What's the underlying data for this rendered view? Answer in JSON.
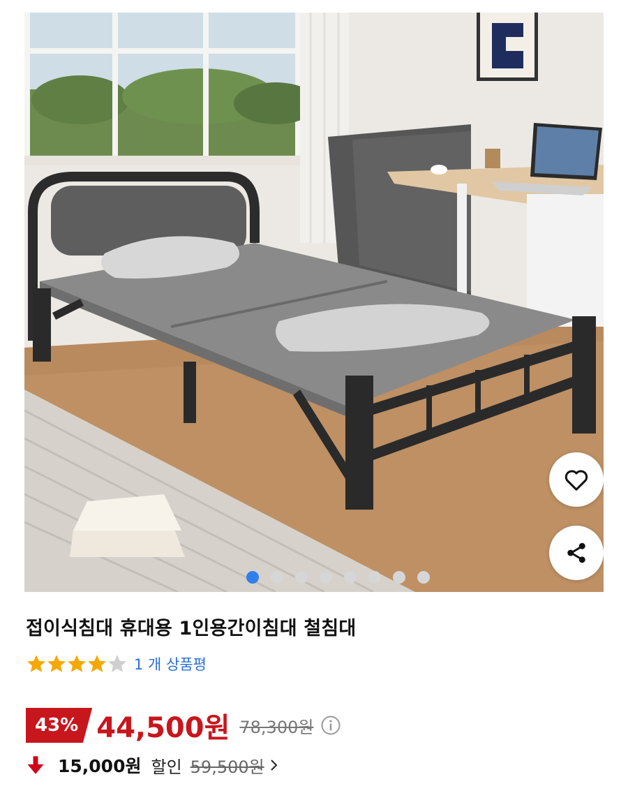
{
  "product": {
    "title": "접이식침대 휴대용 1인용간이침대 철침대",
    "image_count": 8,
    "active_image": 1,
    "rating": 4,
    "max_rating": 5,
    "review_text": "1 개 상품평"
  },
  "pricing": {
    "discount_percent": "43%",
    "sale_price": "44,500원",
    "original_price": "78,300원",
    "coupon_discount": "15,000원",
    "coupon_label": "할인",
    "coupon_base_price": "59,500원"
  },
  "actions": {
    "wishlist_icon": "heart-icon",
    "share_icon": "share-icon"
  },
  "colors": {
    "accent_red": "#c8161d",
    "link_blue": "#2a6fd6",
    "star_gold": "#f6a800",
    "dot_active": "#2f80ed"
  }
}
